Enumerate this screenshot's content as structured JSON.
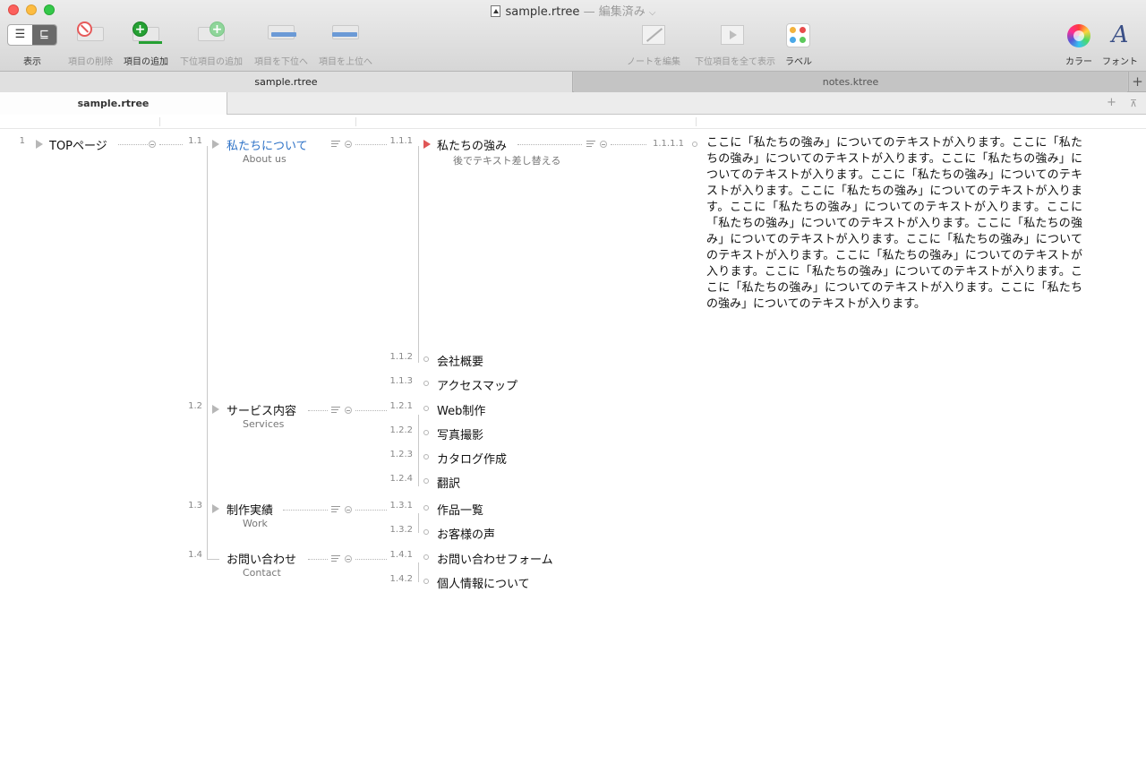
{
  "window": {
    "title": "sample.rtree",
    "status": "— 編集済み"
  },
  "toolbar": {
    "view_label": "表示",
    "delete_label": "項目の削除",
    "add_label": "項目の追加",
    "add_child_label": "下位項目の追加",
    "move_down_label": "項目を下位へ",
    "move_up_label": "項目を上位へ",
    "edit_note_label": "ノートを編集",
    "show_all_label": "下位項目を全て表示",
    "label_label": "ラベル",
    "color_label": "カラー",
    "font_label": "フォント"
  },
  "tabs": [
    {
      "label": "sample.rtree",
      "active": true
    },
    {
      "label": "notes.ktree",
      "active": false
    }
  ],
  "subtab": {
    "label": "sample.rtree"
  },
  "outline": {
    "root": {
      "num": "1",
      "text": "TOPページ"
    },
    "level1": [
      {
        "num": "1.1",
        "text": "私たちについて",
        "note": "About us",
        "selected": true
      },
      {
        "num": "1.2",
        "text": "サービス内容",
        "note": "Services"
      },
      {
        "num": "1.3",
        "text": "制作実績",
        "note": "Work"
      },
      {
        "num": "1.4",
        "text": "お問い合わせ",
        "note": "Contact"
      }
    ],
    "level2": [
      {
        "num": "1.1.1",
        "text": "私たちの強み",
        "note": "後でテキスト差し替える"
      },
      {
        "num": "1.1.2",
        "text": "会社概要"
      },
      {
        "num": "1.1.3",
        "text": "アクセスマップ"
      },
      {
        "num": "1.2.1",
        "text": "Web制作"
      },
      {
        "num": "1.2.2",
        "text": "写真撮影"
      },
      {
        "num": "1.2.3",
        "text": "カタログ作成"
      },
      {
        "num": "1.2.4",
        "text": "翻訳"
      },
      {
        "num": "1.3.1",
        "text": "作品一覧"
      },
      {
        "num": "1.3.2",
        "text": "お客様の声"
      },
      {
        "num": "1.4.1",
        "text": "お問い合わせフォーム"
      },
      {
        "num": "1.4.2",
        "text": "個人情報について"
      }
    ],
    "level3": {
      "num": "1.1.1.1",
      "text": "ここに「私たちの強み」についてのテキストが入ります。ここに「私たちの強み」についてのテキストが入ります。ここに「私たちの強み」についてのテキストが入ります。ここに「私たちの強み」についてのテキストが入ります。ここに「私たちの強み」についてのテキストが入ります。ここに「私たちの強み」についてのテキストが入ります。ここに「私たちの強み」についてのテキストが入ります。ここに「私たちの強み」についてのテキストが入ります。ここに「私たちの強み」についてのテキストが入ります。ここに「私たちの強み」についてのテキストが入ります。ここに「私たちの強み」についてのテキストが入ります。ここに「私たちの強み」についてのテキストが入ります。ここに「私たちの強み」についてのテキストが入ります。"
    }
  },
  "colors": {
    "selected_text": "#2f73c7",
    "marker_red": "#e05656"
  }
}
